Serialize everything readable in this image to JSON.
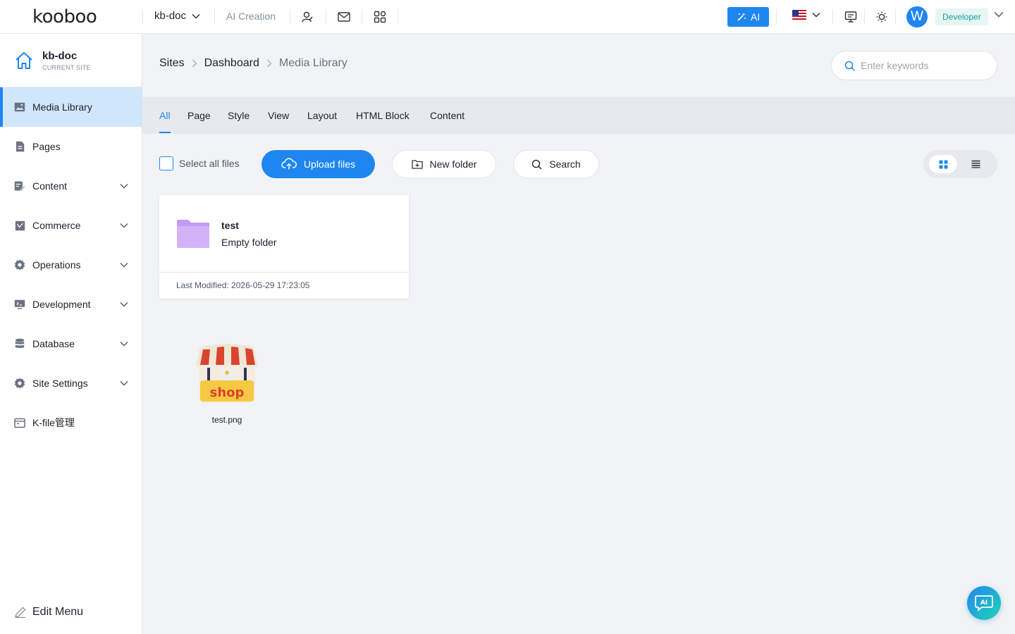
{
  "topbar": {
    "logo_text": "kooboo",
    "site_name": "kb-doc",
    "ai_creation_label": "AI Creation",
    "ai_button_label": "AI",
    "avatar_initial": "W",
    "role_label": "Developer",
    "icons": [
      "user-sign-icon",
      "mail-icon",
      "apps-grid-icon",
      "monitor-icon",
      "sun-icon"
    ],
    "language_flag": "us-flag-icon"
  },
  "sidebar": {
    "current_site": {
      "name": "kb-doc",
      "caption": "CURRENT SITE"
    },
    "items": [
      {
        "label": "Media Library",
        "icon": "image-icon",
        "expandable": false,
        "active": true
      },
      {
        "label": "Pages",
        "icon": "page-icon",
        "expandable": false
      },
      {
        "label": "Content",
        "icon": "edit-doc-icon",
        "expandable": true
      },
      {
        "label": "Commerce",
        "icon": "commerce-icon",
        "expandable": true
      },
      {
        "label": "Operations",
        "icon": "gear-icon",
        "expandable": true
      },
      {
        "label": "Development",
        "icon": "code-icon",
        "expandable": true
      },
      {
        "label": "Database",
        "icon": "database-icon",
        "expandable": true
      },
      {
        "label": "Site Settings",
        "icon": "gear-icon",
        "expandable": true
      },
      {
        "label": "K-file管理",
        "icon": "folder-icon",
        "expandable": false
      }
    ],
    "edit_menu_label": "Edit Menu"
  },
  "breadcrumb": [
    "Sites",
    "Dashboard",
    "Media Library"
  ],
  "search": {
    "placeholder": "Enter keywords"
  },
  "tabs": [
    "All",
    "Page",
    "Style",
    "View",
    "Layout",
    "HTML Block",
    "Content"
  ],
  "toolbar": {
    "select_all_label": "Select all files",
    "upload_label": "Upload files",
    "new_folder_label": "New folder",
    "search_label": "Search"
  },
  "folder": {
    "name": "test",
    "status": "Empty folder",
    "last_modified": "Last Modified: 2026-05-29 17:23:05"
  },
  "file": {
    "name": "test.png",
    "thumb_text": "shop"
  },
  "floating_ai_label": "AI",
  "colors": {
    "accent": "#1f86f0",
    "active_bg": "#cfe6fb",
    "folder": "#c39bf2",
    "role_bg": "#e6f6f4",
    "role_text": "#17a398"
  }
}
